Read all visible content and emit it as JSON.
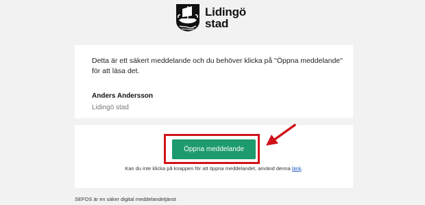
{
  "logo": {
    "line1": "Lidingö",
    "line2": "stad"
  },
  "message": {
    "body": "Detta är ett säkert meddelande och du behöver klicka på \"Öppna meddelande\" för att läsa det.",
    "sender_name": "Anders Andersson",
    "sender_org": "Lidingö stad"
  },
  "action": {
    "open_button_label": "Öppna meddelande",
    "help_text": "Kan du inte klicka på knappen för att öppna meddelandet, använd denna ",
    "link_label": "länk",
    "help_suffix": "."
  },
  "footer": {
    "text": "SEFOS är en säker digital meddelandetjänst"
  },
  "colors": {
    "background": "#f2f2f2",
    "button": "#1d9b6e",
    "highlight": "#d0121b",
    "link": "#1a56c4"
  },
  "icons": {
    "crest": "lidingo-crest-icon",
    "arrow": "red-arrow-icon"
  }
}
